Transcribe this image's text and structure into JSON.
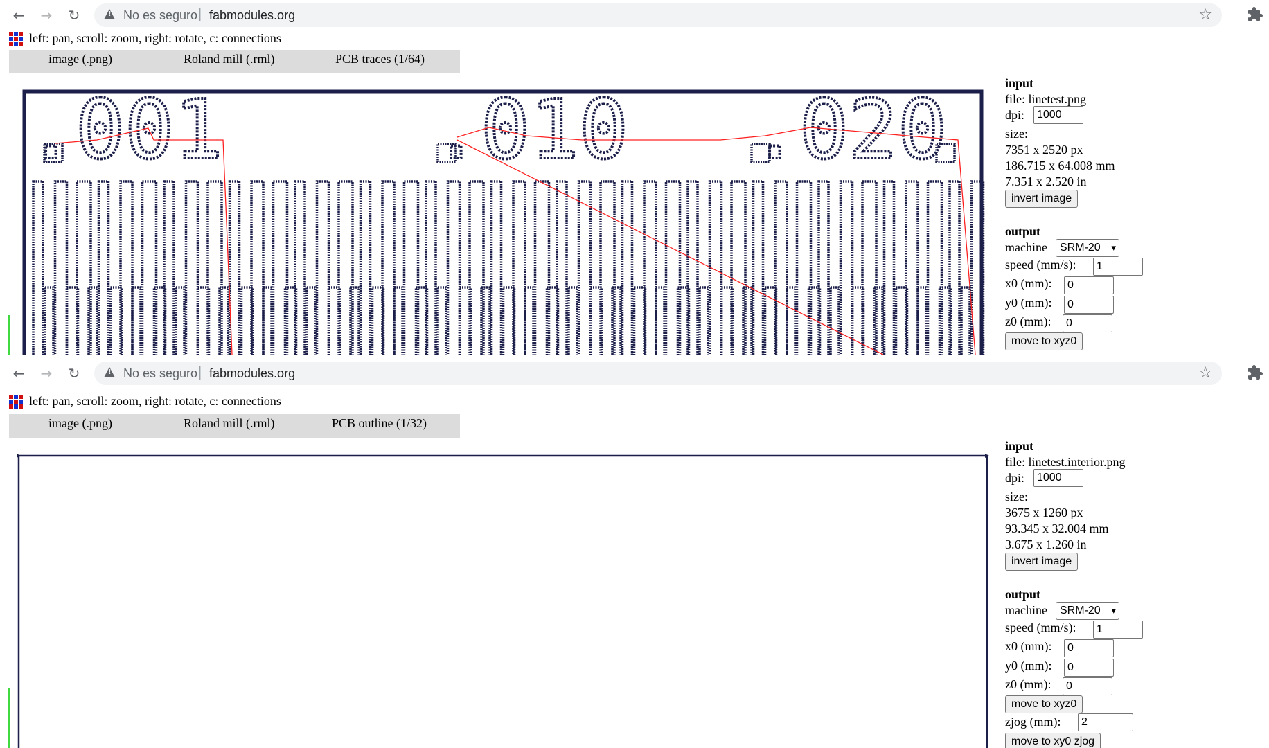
{
  "browser": {
    "security_label": "No es seguro",
    "host": "fabmodules.org"
  },
  "windows": [
    {
      "help_text": "left: pan, scroll: zoom, right: rotate, c: connections",
      "menu": [
        "image (.png)",
        "Roland mill (.rml)",
        "PCB traces (1/64)"
      ],
      "preview": {
        "labels": [
          ".001",
          ".010",
          ".020"
        ],
        "trace_color": "#1c1f4a",
        "connection_color": "#ff2020"
      },
      "input": {
        "heading": "input",
        "file_label": "file:",
        "file": "linetest.png",
        "dpi_label": "dpi:",
        "dpi": "1000",
        "size_label": "size:",
        "size_px": "7351 x 2520 px",
        "size_mm": "186.715 x 64.008 mm",
        "size_in": "7.351 x 2.520 in",
        "invert_button": "invert image"
      },
      "output": {
        "heading": "output",
        "machine_label": "machine",
        "machine": "SRM-20",
        "speed_label": "speed (mm/s):",
        "speed": "1",
        "x0_label": "x0 (mm):",
        "x0": "0",
        "y0_label": "y0 (mm):",
        "y0": "0",
        "z0_label": "z0 (mm):",
        "z0": "0",
        "move_button": "move to xyz0"
      }
    },
    {
      "help_text": "left: pan, scroll: zoom, right: rotate, c: connections",
      "menu": [
        "image (.png)",
        "Roland mill (.rml)",
        "PCB outline (1/32)"
      ],
      "input": {
        "heading": "input",
        "file_label": "file:",
        "file": "linetest.interior.png",
        "dpi_label": "dpi:",
        "dpi": "1000",
        "size_label": "size:",
        "size_px": "3675 x 1260 px",
        "size_mm": "93.345 x 32.004 mm",
        "size_in": "3.675 x 1.260 in",
        "invert_button": "invert image"
      },
      "output": {
        "heading": "output",
        "machine_label": "machine",
        "machine": "SRM-20",
        "speed_label": "speed (mm/s):",
        "speed": "1",
        "x0_label": "x0 (mm):",
        "x0": "0",
        "y0_label": "y0 (mm):",
        "y0": "0",
        "z0_label": "z0 (mm):",
        "z0": "0",
        "move_button": "move to xyz0",
        "zjog_label": "zjog (mm):",
        "zjog": "2",
        "move_xy_button": "move to xy0 zjog"
      }
    }
  ]
}
